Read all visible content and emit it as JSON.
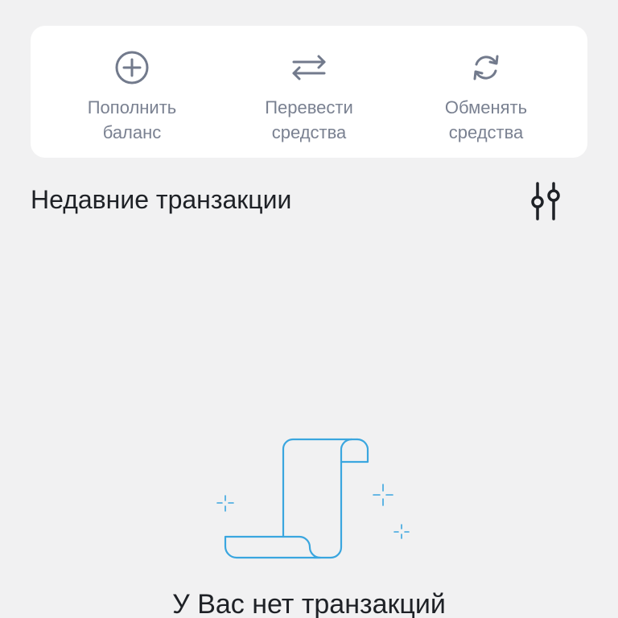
{
  "actions": [
    {
      "label": "Пополнить\nбаланс",
      "icon": "plus-circle-icon"
    },
    {
      "label": "Перевести\nсредства",
      "icon": "transfer-arrows-icon"
    },
    {
      "label": "Обменять\nсредства",
      "icon": "exchange-refresh-icon"
    }
  ],
  "recent": {
    "title": "Недавние транзакции",
    "filter_icon": "filter-sliders-icon"
  },
  "empty_state": {
    "illustration": "receipt-scroll-icon",
    "message": "У Вас нет транзакций"
  },
  "colors": {
    "background": "#f1f1f2",
    "card": "#ffffff",
    "icon_gray": "#727a8c",
    "text_dark": "#1e2126",
    "illustration_blue": "#3aa6df"
  }
}
